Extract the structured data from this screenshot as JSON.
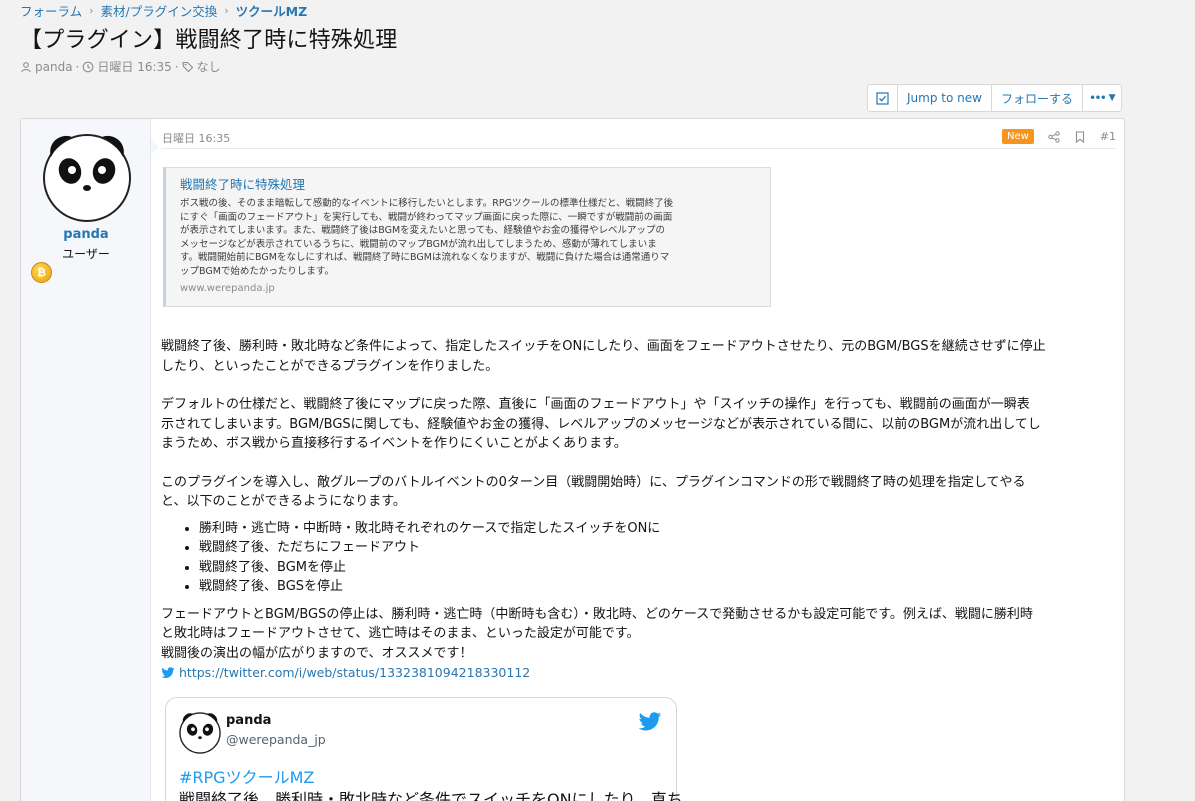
{
  "breadcrumb": {
    "items": [
      "フォーラム",
      "素材/プラグイン交換",
      "ツクールMZ"
    ]
  },
  "page_title": "【プラグイン】戦闘終了時に特殊処理",
  "thread_meta": {
    "author": "panda",
    "date": "日曜日 16:35",
    "tags": "なし"
  },
  "toolbar": {
    "jump_label": "Jump to new",
    "follow_label": "フォローする",
    "more_label": "•••"
  },
  "user": {
    "name": "panda",
    "title": "ユーザー",
    "trophy": "₿"
  },
  "post": {
    "date": "日曜日 16:35",
    "new_badge": "New",
    "number": "#1",
    "unfurl": {
      "title": "戦闘終了時に特殊処理",
      "description_lines": [
        "ボス戦の後、そのまま暗転して感動的なイベントに移行したいとします。RPGツクールの標準仕様だと、戦闘終了後",
        "にすぐ「画面のフェードアウト」を実行しても、戦闘が終わってマップ画面に戻った際に、一瞬ですが戦闘前の画面",
        "が表示されてしまいます。また、戦闘終了後はBGMを変えたいと思っても、経験値やお金の獲得やレベルアップの",
        "メッセージなどが表示されているうちに、戦闘前のマップBGMが流れ出してしまうため、感動が薄れてしまいま",
        "す。戦闘開始前にBGMをなしにすれば、戦闘終了時にBGMは流れなくなりますが、戦闘に負けた場合は通常通りマ",
        "ップBGMで始めたかったりします。"
      ],
      "domain": "www.werepanda.jp"
    },
    "paragraphs": [
      [
        "戦闘終了後、勝利時・敗北時など条件によって、指定したスイッチをONにしたり、画面をフェードアウトさせたり、元のBGM/BGSを継続させずに停止",
        "したり、といったことができるプラグインを作りました。"
      ],
      [
        "デフォルトの仕様だと、戦闘終了後にマップに戻った際、直後に「画面のフェードアウト」や「スイッチの操作」を行っても、戦闘前の画面が一瞬表",
        "示されてしまいます。BGM/BGSに関しても、経験値やお金の獲得、レベルアップのメッセージなどが表示されている間に、以前のBGMが流れ出してし",
        "まうため、ボス戦から直接移行するイベントを作りにくいことがよくあります。"
      ],
      [
        "このプラグインを導入し、敵グループのバトルイベントの0ターン目（戦闘開始時）に、プラグインコマンドの形で戦闘終了時の処理を指定してやる",
        "と、以下のことができるようになります。"
      ]
    ],
    "bullets": [
      "勝利時・逃亡時・中断時・敗北時それぞれのケースで指定したスイッチをONに",
      "戦闘終了後、ただちにフェードアウト",
      "戦闘終了後、BGMを停止",
      "戦闘終了後、BGSを停止"
    ],
    "closing": [
      "フェードアウトとBGM/BGSの停止は、勝利時・逃亡時（中断時も含む）・敗北時、どのケースで発動させるかも設定可能です。例えば、戦闘に勝利時",
      "と敗北時はフェードアウトさせて、逃亡時はそのまま、といった設定が可能です。",
      "戦闘後の演出の幅が広がりますので、オススメです！"
    ],
    "twitter_link": "https://twitter.com/i/web/status/1332381094218330112"
  },
  "tweet": {
    "name": "panda",
    "handle": "@werepanda_jp",
    "hashtag": "#RPGツクールMZ",
    "text": "戦闘終了後、勝利時・敗北時など条件でスイッチをONにしたり、直ち"
  },
  "colors": {
    "link": "#2577b1",
    "badge": "#f7941d",
    "twitter": "#1d9bf0"
  }
}
